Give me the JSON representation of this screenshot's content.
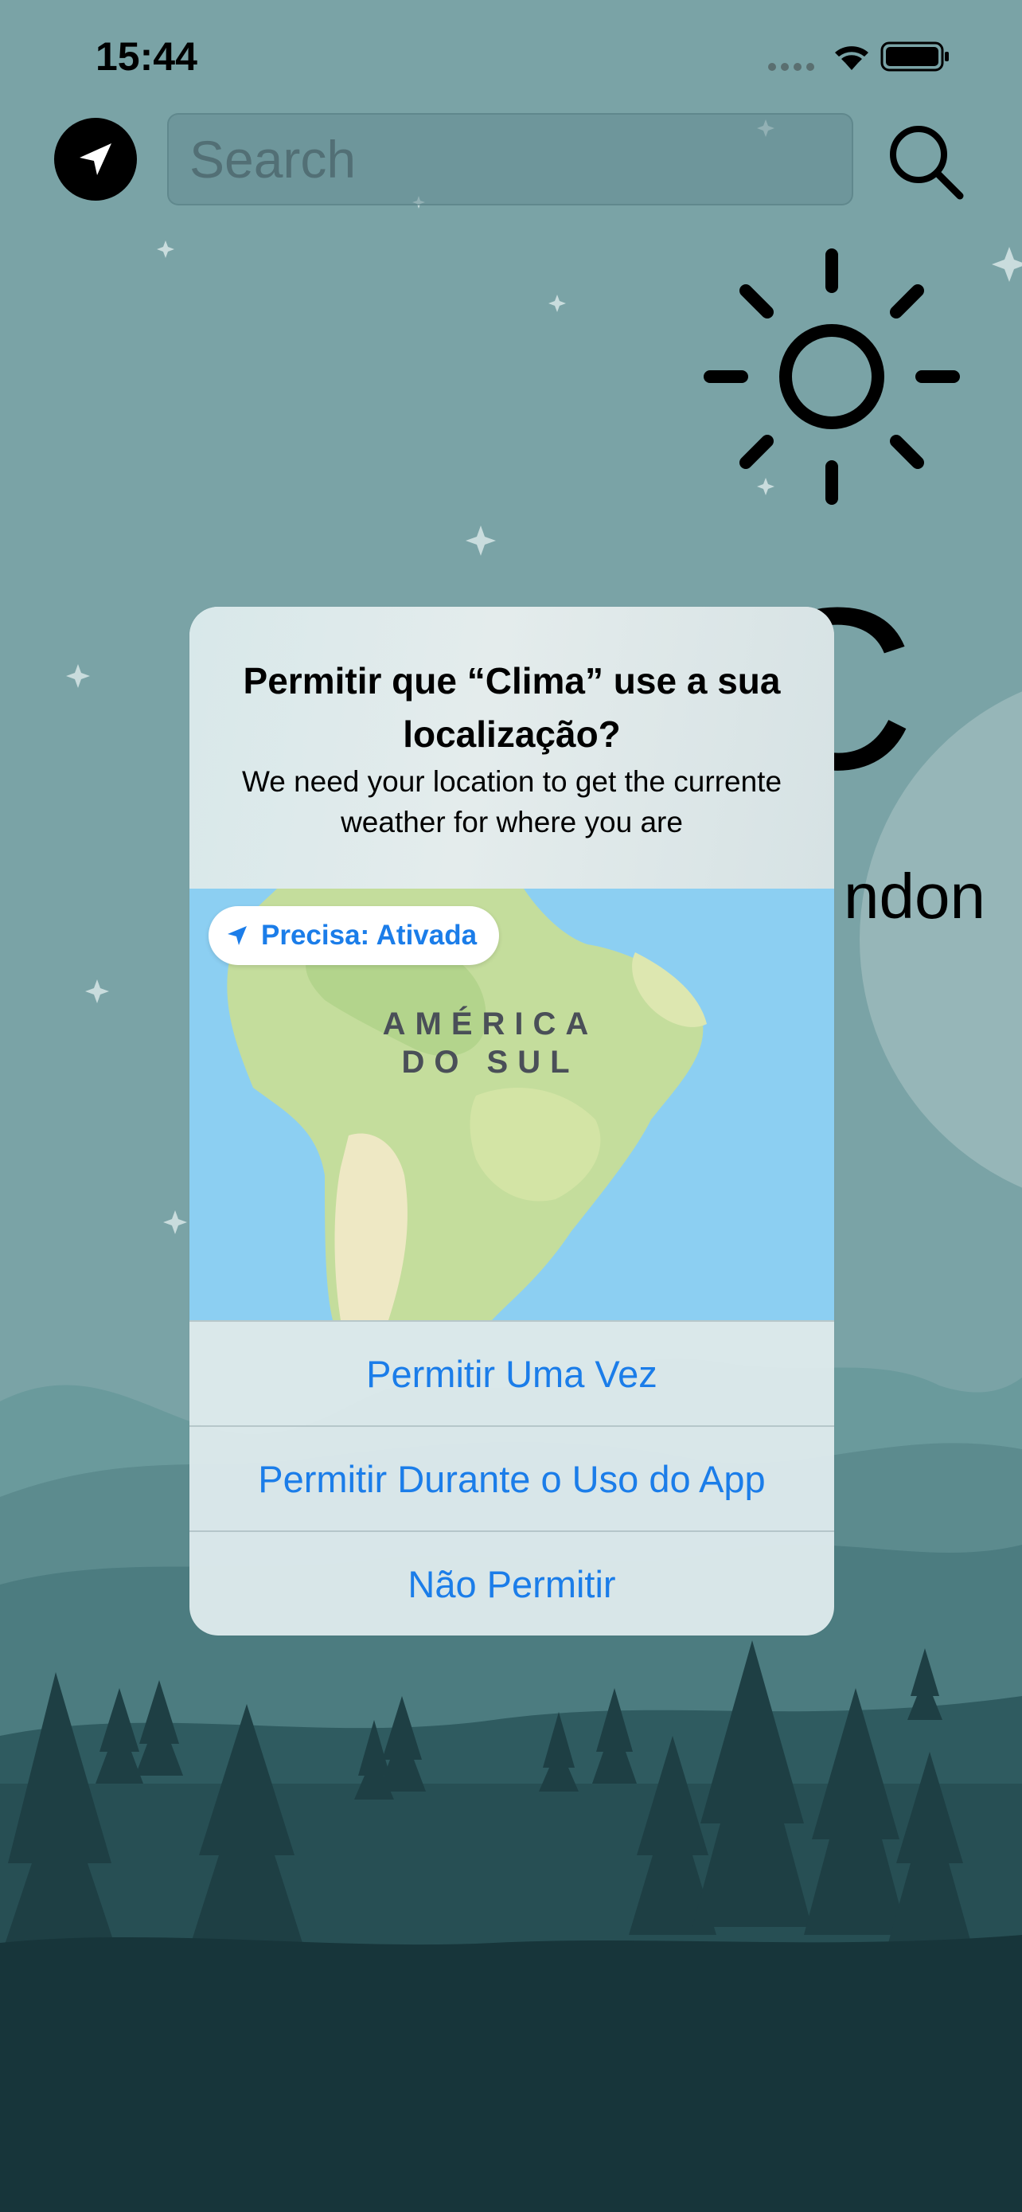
{
  "status_bar": {
    "time": "15:44",
    "icons": [
      "signal-icon",
      "wifi-icon",
      "battery-icon"
    ]
  },
  "header": {
    "location_icon": "location-arrow-icon",
    "search_placeholder": "Search",
    "search_icon": "magnifier-icon"
  },
  "weather": {
    "condition_icon": "sun-icon",
    "temperature_visible": "C",
    "city_visible": "ndon"
  },
  "permission_dialog": {
    "title": "Permitir que “Clima” use a sua localização?",
    "message": "We need your location to get the currente weather for where you are",
    "precise_label": "Precisa: Ativada",
    "map_label_line1": "AMÉRICA",
    "map_label_line2": "DO SUL",
    "buttons": {
      "allow_once": "Permitir Uma Vez",
      "allow_while_using": "Permitir Durante o Uso do App",
      "dont_allow": "Não Permitir"
    }
  },
  "colors": {
    "accent": "#1b7de9",
    "sky": "#7aa3a6",
    "forest_dark": "#17353a"
  }
}
